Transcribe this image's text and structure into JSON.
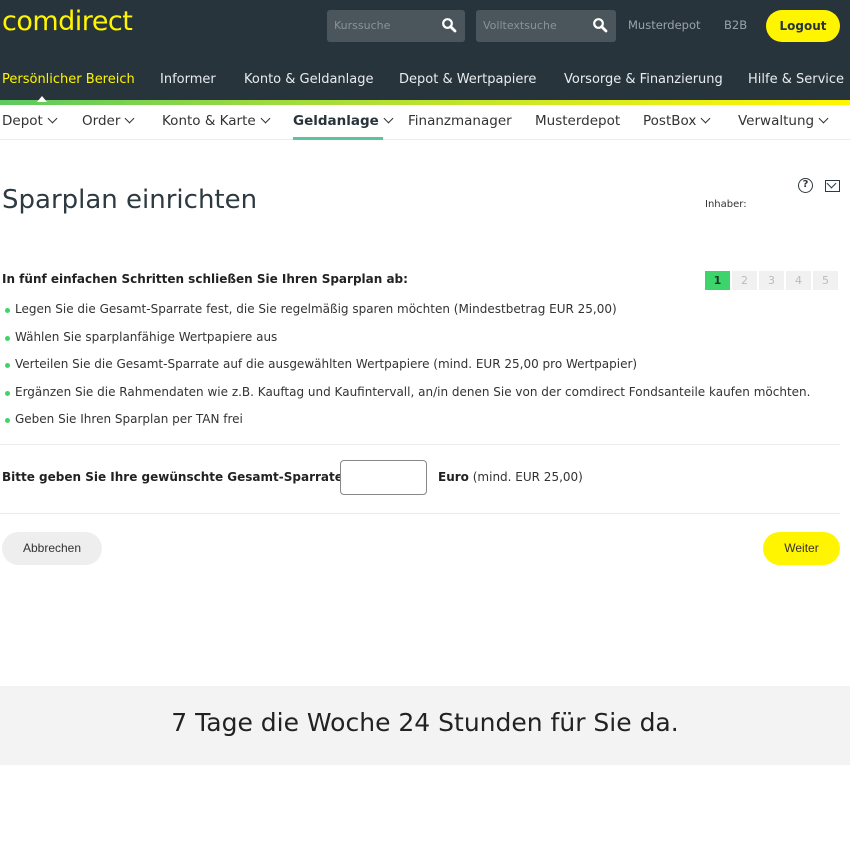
{
  "header": {
    "logo": "comdirect",
    "search1_placeholder": "Kurssuche",
    "search2_placeholder": "Volltextsuche",
    "links": [
      "Musterdepot",
      "B2B"
    ],
    "logout_label": "Logout"
  },
  "main_nav": {
    "items": [
      {
        "label": "Persönlicher Bereich",
        "active": true
      },
      {
        "label": "Informer"
      },
      {
        "label": "Konto & Geldanlage"
      },
      {
        "label": "Depot & Wertpapiere"
      },
      {
        "label": "Vorsorge & Finanzierung"
      },
      {
        "label": "Hilfe & Service"
      }
    ]
  },
  "sub_nav": {
    "items": [
      {
        "label": "Depot",
        "has_dropdown": true
      },
      {
        "label": "Order",
        "has_dropdown": true
      },
      {
        "label": "Konto & Karte",
        "has_dropdown": true
      },
      {
        "label": "Geldanlage",
        "has_dropdown": true,
        "active": true
      },
      {
        "label": "Finanzmanager"
      },
      {
        "label": "Musterdepot"
      },
      {
        "label": "PostBox",
        "has_dropdown": true
      },
      {
        "label": "Verwaltung",
        "has_dropdown": true
      }
    ]
  },
  "page": {
    "title": "Sparplan einrichten",
    "inhaber_label": "Inhaber:",
    "intro": "In fünf einfachen Schritten schließen Sie Ihren Sparplan ab:",
    "steps": [
      "1",
      "2",
      "3",
      "4",
      "5"
    ],
    "current_step": 1,
    "bullets": [
      "Legen Sie die Gesamt-Sparrate fest, die Sie regelmäßig sparen möchten (Mindestbetrag EUR 25,00)",
      "Wählen Sie sparplanfähige Wertpapiere aus",
      "Verteilen Sie die Gesamt-Sparrate auf die ausgewählten Wertpapiere (mind. EUR 25,00 pro Wertpapier)",
      "Ergänzen Sie die Rahmendaten wie z.B. Kauftag und Kaufintervall, an/in denen Sie von der comdirect Fondsanteile kaufen möchten.",
      "Geben Sie Ihren Sparplan per TAN frei"
    ],
    "amount_label": "Bitte geben Sie Ihre gewünschte Gesamt-Sparrate ein:",
    "amount_value": "",
    "currency": "Euro",
    "min_hint": "(mind. EUR 25,00)",
    "cancel_label": "Abbrechen",
    "next_label": "Weiter"
  },
  "footer": {
    "tagline": "7 Tage die Woche 24 Stunden für Sie da."
  },
  "colors": {
    "header_bg": "#28343b",
    "brand_yellow": "#fff500",
    "step_active": "#3dd56b",
    "bullet": "#3dd56b"
  }
}
